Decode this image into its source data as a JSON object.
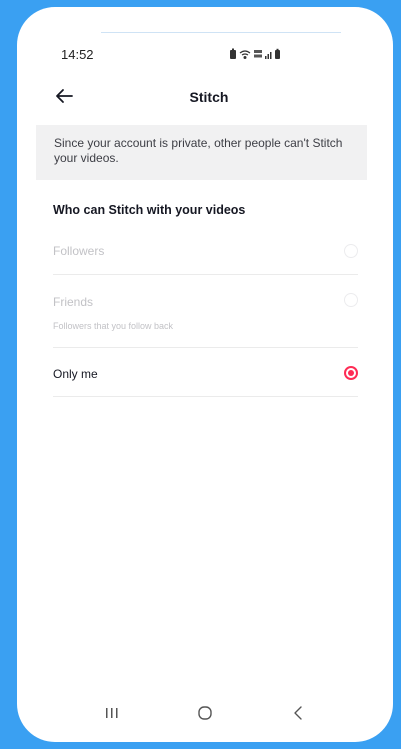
{
  "status_bar": {
    "time": "14:52",
    "icons": [
      "battery-saver-icon",
      "wifi-icon",
      "volte-icon",
      "signal-icon",
      "battery-icon"
    ]
  },
  "nav": {
    "title": "Stitch",
    "back_icon": "arrow-left-icon"
  },
  "notice": {
    "text": "Since your account is private, other people can't Stitch your videos."
  },
  "section": {
    "title": "Who can Stitch with your videos"
  },
  "options": [
    {
      "label": "Followers",
      "sublabel": "",
      "selected": false,
      "disabled": true
    },
    {
      "label": "Friends",
      "sublabel": "Followers that you follow back",
      "selected": false,
      "disabled": true
    },
    {
      "label": "Only me",
      "sublabel": "",
      "selected": true,
      "disabled": false
    }
  ],
  "system_nav": {
    "icons": [
      "recent-apps-icon",
      "home-icon",
      "back-icon"
    ]
  },
  "colors": {
    "background": "#3aa0f2",
    "accent": "#fe2c55",
    "notice_bg": "#f1f1f2",
    "disabled_text": "#c2c2c6"
  }
}
